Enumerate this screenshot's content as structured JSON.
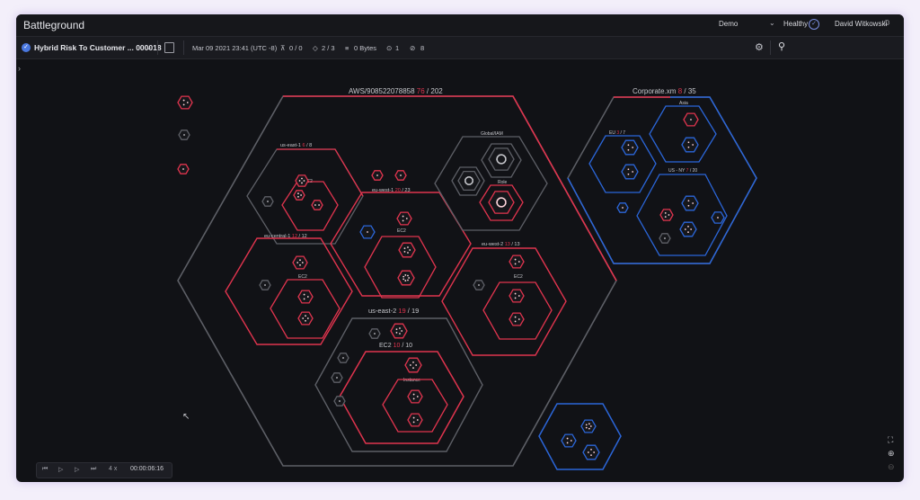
{
  "app": {
    "title": "Battleground"
  },
  "header": {
    "environment": "Demo",
    "health": "Healthy",
    "user": "David Witkowski"
  },
  "toolbar": {
    "scenario": "Hybrid Risk To Customer ... 000018",
    "timestamp": "Mar 09 2021 23:41 (UTC -8)",
    "stat1": "0 / 0",
    "stat2": "2 / 3",
    "bytes": "0 Bytes",
    "stat4": "1",
    "stat5": "8"
  },
  "graph": {
    "aws": {
      "label": "AWS/908522078858",
      "hit": "76",
      "total": "/ 202"
    },
    "corporate": {
      "label": "Corporate.xm",
      "hit": "8",
      "total": "/ 35"
    },
    "us_east_1": {
      "label": "us-east-1",
      "hit": "6",
      "total": "/ 8",
      "sub": "EC2"
    },
    "eu_west_1": {
      "label": "eu-west-1",
      "hit": "20",
      "total": "/ 23",
      "sub": "EC2"
    },
    "eu_central_1": {
      "label": "eu-central-1",
      "hit": "12",
      "total": "/ 12",
      "sub": "EC2"
    },
    "eu_west_2": {
      "label": "eu-west-2",
      "hit": "13",
      "total": "/ 13",
      "sub": "EC2"
    },
    "us_east_2": {
      "label": "us-east-2",
      "hit": "19",
      "total": "/ 19"
    },
    "ec2": {
      "label": "EC2",
      "hit": "10",
      "total": "/ 10",
      "instance": "Instance"
    },
    "global_iam": {
      "label": "Global/IAM",
      "role": "Role"
    },
    "asia": {
      "label": "Asia"
    },
    "eu": {
      "label": "EU",
      "hit": "3",
      "total": "/ 7"
    },
    "us_ny": {
      "label": "US - NY",
      "hit": "7",
      "total": "/ 20"
    }
  },
  "player": {
    "speed": "4 x",
    "time": "00:00:06:16"
  },
  "colors": {
    "red": "#e0344e",
    "blue": "#2b66d9",
    "gray": "#5d5f66",
    "bg": "#111216"
  }
}
